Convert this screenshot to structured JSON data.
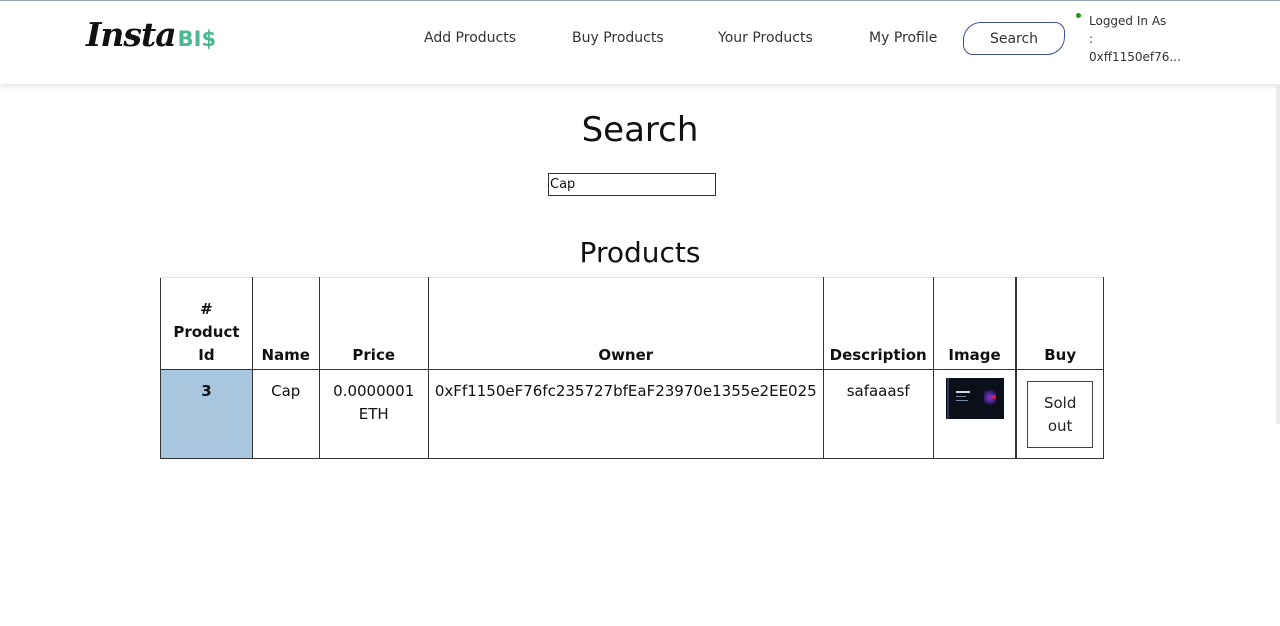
{
  "logo": {
    "main": "Insta",
    "accent": "BI$"
  },
  "nav": {
    "links": [
      "Add Products",
      "Buy Products",
      "Your Products",
      "My Profile"
    ],
    "search_label": "Search"
  },
  "login": {
    "line1": "Logged In As",
    "line2": ":",
    "address": "0xff1150ef76..."
  },
  "page_title": "Search",
  "search_input": {
    "value": "Cap",
    "placeholder": ""
  },
  "section_title": "Products",
  "table": {
    "headers": [
      "# Product Id",
      "Name",
      "Price",
      "Owner",
      "Description",
      "Image",
      "Buy"
    ],
    "rows": [
      {
        "id": "3",
        "name": "Cap",
        "price": "0.0000001 ETH",
        "owner": "0xFf1150eF76fc235727bfEaF23970e1355e2EE025",
        "description": "safaaasf",
        "image": "product-thumbnail",
        "buy_label": "Sold out"
      }
    ]
  },
  "colors": {
    "accent": "#4cb891",
    "search_border": "#3f4fa0",
    "id_cell_bg": "#a8c7df",
    "status_dot": "#1a9b1a"
  }
}
